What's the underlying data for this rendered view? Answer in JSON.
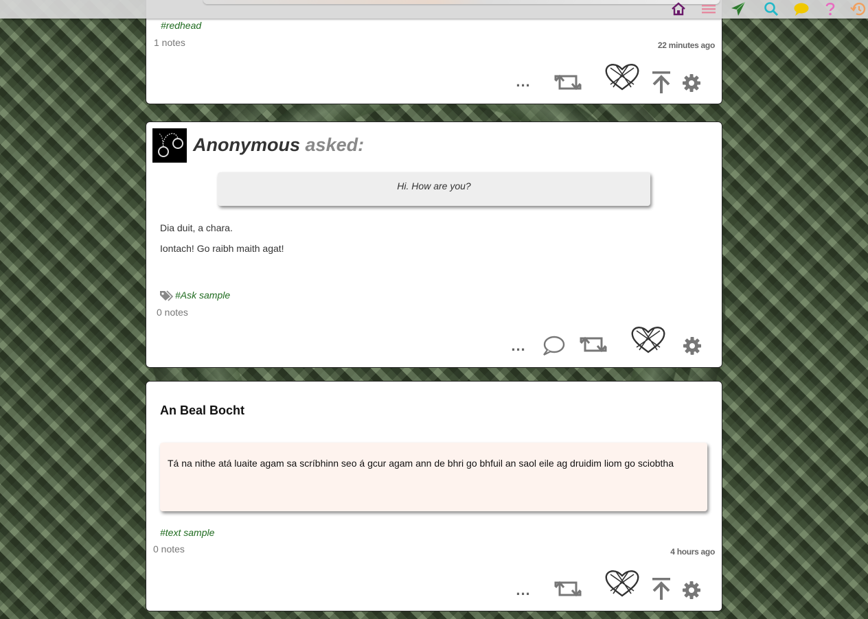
{
  "nav": {
    "icons": [
      "home-icon",
      "menu-icon",
      "send-icon",
      "search-icon",
      "chat-icon",
      "help-icon",
      "history-icon"
    ],
    "colors": {
      "home": "#6a1a6a",
      "menu": "#e58aa0",
      "send": "#2e7a2e",
      "search": "#22b8c8",
      "chat": "#f0c800",
      "help": "#e86ac0",
      "history": "#f0a060"
    }
  },
  "post1": {
    "tag": "#redhead",
    "notes": "1 notes",
    "time": "22 minutes ago"
  },
  "post2": {
    "author": "Anonymous",
    "asked": "asked:",
    "question": "Hi. How are you?",
    "answer_line1": "Dia duit, a chara.",
    "answer_line2": "Iontach! Go raibh maith agat!",
    "tag": "#Ask sample",
    "notes": "0 notes"
  },
  "post3": {
    "title": "An Beal Bocht",
    "body": "Tá na nithe atá luaite agam sa scríbhinn seo á gcur agam ann de bhri go bhfuil an saol eile ag druidim liom go sciobtha",
    "tag": "#text sample",
    "notes": "0 notes",
    "time": "4 hours ago"
  },
  "actions": {
    "more": "...",
    "icons": [
      "more-icon",
      "reblog-icon",
      "like-heart-icon",
      "top-arrow-icon",
      "settings-gear-icon",
      "comment-icon"
    ]
  },
  "colors": {
    "tag": "#1f6b1f",
    "accent_gray": "#808080"
  }
}
